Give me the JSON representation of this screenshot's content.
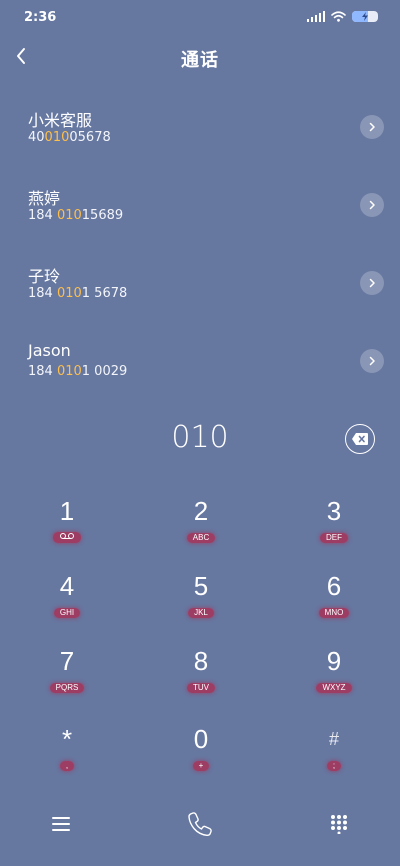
{
  "status_bar": {
    "time": "2:36",
    "icons": [
      "signal-icon",
      "wifi-icon",
      "battery-charging-icon"
    ]
  },
  "header": {
    "title": "通话",
    "back_icon": "chevron-left-icon"
  },
  "contacts": [
    {
      "name": "小米客服",
      "number_pre": "40",
      "number_match": "010",
      "number_post": "05678"
    },
    {
      "name": "燕婷",
      "number_pre": "184 ",
      "number_match": "010",
      "number_post": "15689"
    },
    {
      "name": "子玲",
      "number_pre": "184 ",
      "number_match": "010",
      "number_post": "1 5678"
    },
    {
      "name": "Jason",
      "number_pre": "184 ",
      "number_match": "010",
      "number_post": "1 0029"
    }
  ],
  "dialer": {
    "dialed": "010",
    "backspace_icon": "backspace-icon"
  },
  "keypad": [
    {
      "digit": "1",
      "letters": ""
    },
    {
      "digit": "2",
      "letters": "ABC"
    },
    {
      "digit": "3",
      "letters": "DEF"
    },
    {
      "digit": "4",
      "letters": "GHI"
    },
    {
      "digit": "5",
      "letters": "JKL"
    },
    {
      "digit": "6",
      "letters": "MNO"
    },
    {
      "digit": "7",
      "letters": "PQRS"
    },
    {
      "digit": "8",
      "letters": "TUV"
    },
    {
      "digit": "9",
      "letters": "WXYZ"
    },
    {
      "digit": "*",
      "letters": ","
    },
    {
      "digit": "0",
      "letters": "+"
    },
    {
      "digit": "#",
      "letters": ";"
    }
  ],
  "bottom_bar": {
    "icons": [
      "menu-icon",
      "phone-icon",
      "keypad-icon"
    ]
  },
  "colors": {
    "background": "#6677a0",
    "highlight": "#ffbf4a",
    "letter_badge": "#bc1f44"
  }
}
